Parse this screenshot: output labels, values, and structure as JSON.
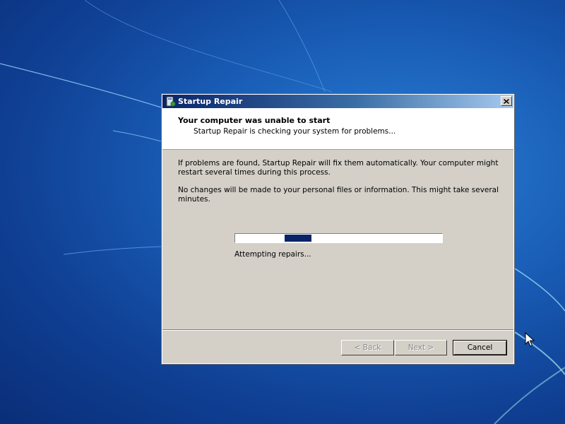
{
  "window": {
    "title": "Startup Repair",
    "title_icon": "startup-repair-icon",
    "close_icon": "close-icon"
  },
  "header": {
    "title": "Your computer was unable to start",
    "subtitle": "Startup Repair is checking your system for problems..."
  },
  "body": {
    "paragraph_1": "If problems are found, Startup Repair will fix them automatically. Your computer might restart several times during this process.",
    "paragraph_2": "No changes will be made to your personal files or information. This might take several minutes."
  },
  "progress": {
    "label": "Attempting repairs...",
    "style": "marquee",
    "color": "#0a246a"
  },
  "buttons": {
    "back": "< Back",
    "next": "Next >",
    "cancel": "Cancel"
  },
  "colors": {
    "desktop": "#1a5fb8",
    "title_bar_start": "#0a246a",
    "title_bar_end": "#a6caf0",
    "dialog_face": "#d4d0c8"
  }
}
